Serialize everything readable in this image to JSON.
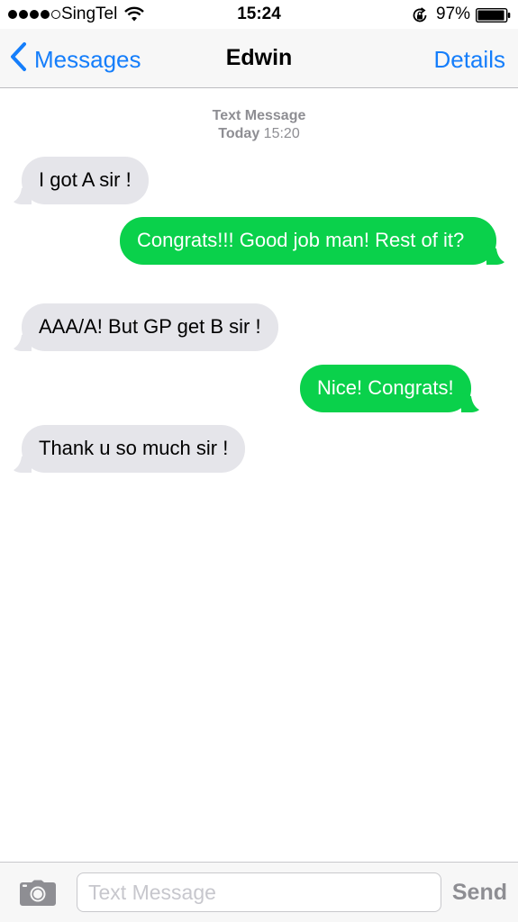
{
  "status_bar": {
    "carrier": "SingTel",
    "time": "15:24",
    "battery": "97%",
    "signal_bars_filled": 4,
    "signal_bars_total": 5,
    "battery_level": 0.97
  },
  "nav": {
    "back_label": "Messages",
    "title": "Edwin",
    "details_label": "Details"
  },
  "thread_header": {
    "service": "Text Message",
    "day": "Today",
    "time": "15:20"
  },
  "messages": [
    {
      "direction": "incoming",
      "text": "I got A sir !"
    },
    {
      "direction": "outgoing",
      "text": "Congrats!!! Good job man! Rest of it?"
    },
    {
      "direction": "incoming",
      "text": "AAA/A! But GP get B sir !"
    },
    {
      "direction": "outgoing",
      "text": "Nice! Congrats!"
    },
    {
      "direction": "incoming",
      "text": "Thank u so much sir !"
    }
  ],
  "input": {
    "placeholder": "Text Message",
    "value": "",
    "send_label": "Send"
  },
  "colors": {
    "accent": "#157efb",
    "outgoing_bubble": "#0ad14b",
    "incoming_bubble": "#e5e5ea"
  },
  "icons": [
    "wifi-icon",
    "rotation-lock-icon",
    "battery-icon",
    "chevron-left-icon",
    "camera-icon"
  ]
}
